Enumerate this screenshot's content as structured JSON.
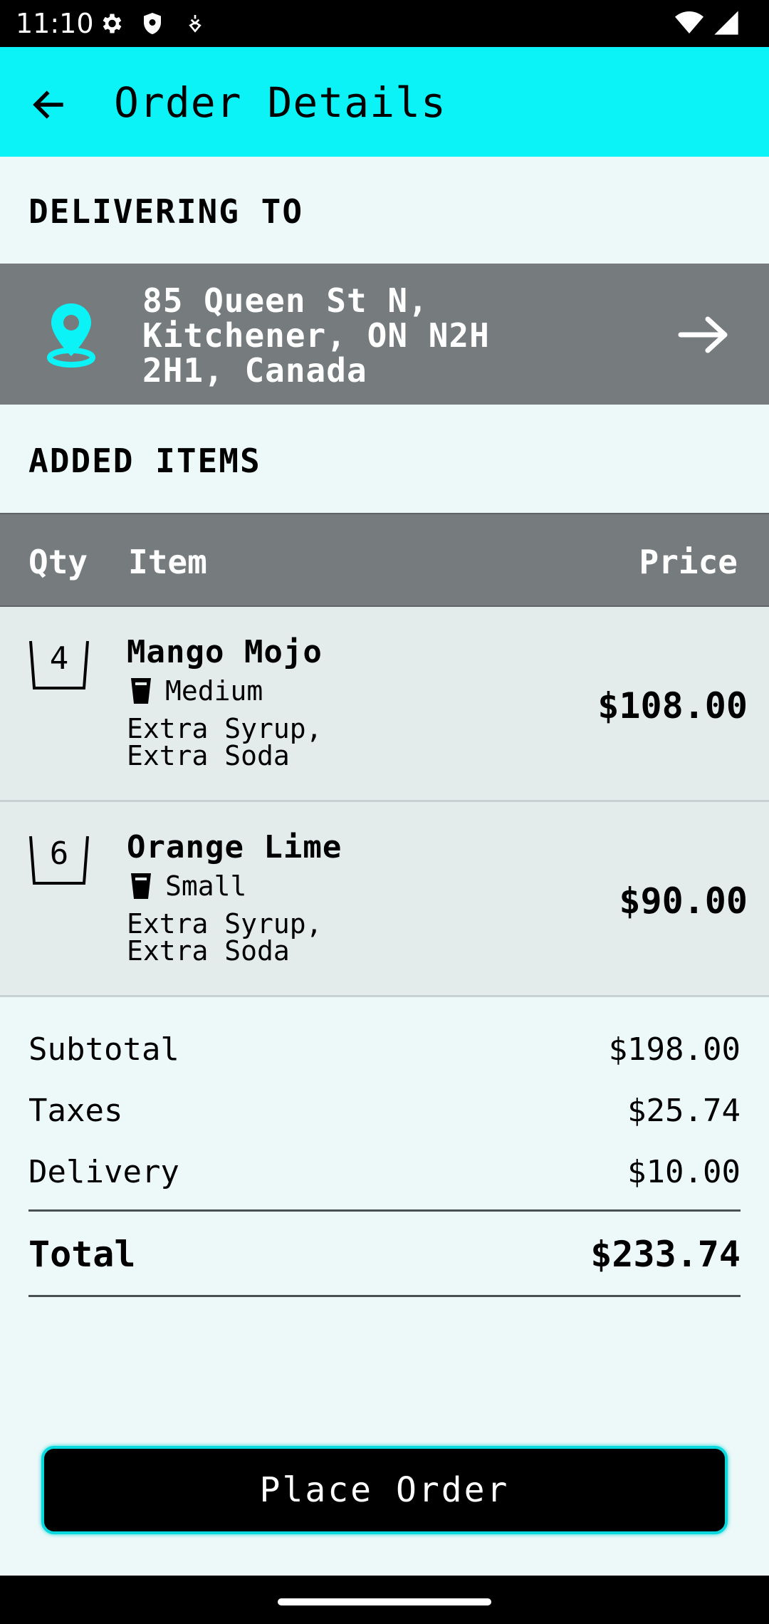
{
  "status_bar": {
    "time": "11:10"
  },
  "app_bar": {
    "title": "Order Details"
  },
  "delivery": {
    "heading": "DELIVERING TO",
    "address_lines": [
      "85 Queen St N,",
      "Kitchener, ON N2H",
      "2H1, Canada"
    ]
  },
  "items_section": {
    "heading": "ADDED ITEMS",
    "columns": {
      "qty": "Qty",
      "item": "Item",
      "price": "Price"
    },
    "items": [
      {
        "qty": "4",
        "name": "Mango Mojo",
        "size": "Medium",
        "extras_line1": "Extra Syrup,",
        "extras_line2": "Extra Soda",
        "price": "$108.00"
      },
      {
        "qty": "6",
        "name": "Orange Lime",
        "size": "Small",
        "extras_line1": "Extra Syrup,",
        "extras_line2": "Extra Soda",
        "price": "$90.00"
      }
    ]
  },
  "summary": {
    "subtotal_label": "Subtotal",
    "subtotal": "$198.00",
    "taxes_label": "Taxes",
    "taxes": "$25.74",
    "delivery_label": "Delivery",
    "delivery": "$10.00",
    "total_label": "Total",
    "total": "$233.74"
  },
  "action": {
    "place_order": "Place Order"
  },
  "colors": {
    "accent": "#0bf3f6",
    "header_gray": "#767c7e",
    "background": "#edf8f8",
    "row_bg": "#e3ebeb"
  },
  "icons": [
    "settings-icon",
    "shield-icon",
    "debug-icon",
    "wifi-icon",
    "signal-icon",
    "back-arrow-icon",
    "location-pin-icon",
    "forward-arrow-icon",
    "basket-icon",
    "cup-icon"
  ]
}
